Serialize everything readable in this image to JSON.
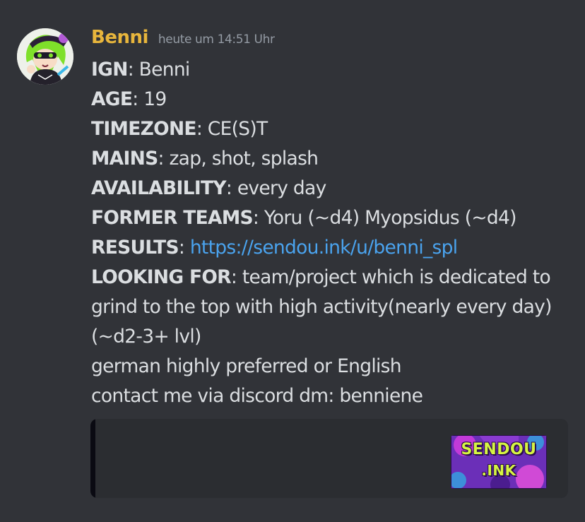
{
  "message": {
    "author": "Benni",
    "timestamp": "heute um 14:51 Uhr",
    "author_color": "#e8b63c",
    "lines": [
      {
        "key": "IGN",
        "sep": ":",
        "value": " Benni"
      },
      {
        "key": "AGE",
        "sep": ":",
        "value": " 19"
      },
      {
        "key": "TIMEZONE",
        "sep": ":",
        "value": " CE(S)T"
      },
      {
        "key": "MAINS",
        "sep": ":",
        "value": " zap, shot, splash"
      },
      {
        "key": "AVAILABILITY",
        "sep": ":",
        "value": " every day"
      },
      {
        "key": "FORMER TEAMS",
        "sep": ":",
        "value": " Yoru (~d4) Myopsidus (~d4)"
      },
      {
        "key": "RESULTS",
        "sep": ": ",
        "link": "https://sendou.ink/u/benni_spl"
      },
      {
        "key": "LOOKING FOR",
        "sep": ":",
        "value": " team/project which is dedicated to grind to the top with high activity(nearly every day)(~d2-3+ lvl)"
      },
      {
        "value": "german highly preferred or English"
      },
      {
        "value": "contact me via discord dm: benniene"
      }
    ]
  },
  "embed": {
    "thumbnail_line1": "SENDOU",
    "thumbnail_line2": ".INK",
    "thumbnail_icon": "sendou-ink-logo"
  },
  "colors": {
    "background": "#313338",
    "link": "#4aa3ee",
    "embed_bg": "#2b2d31",
    "timestamp": "#949ba4"
  }
}
